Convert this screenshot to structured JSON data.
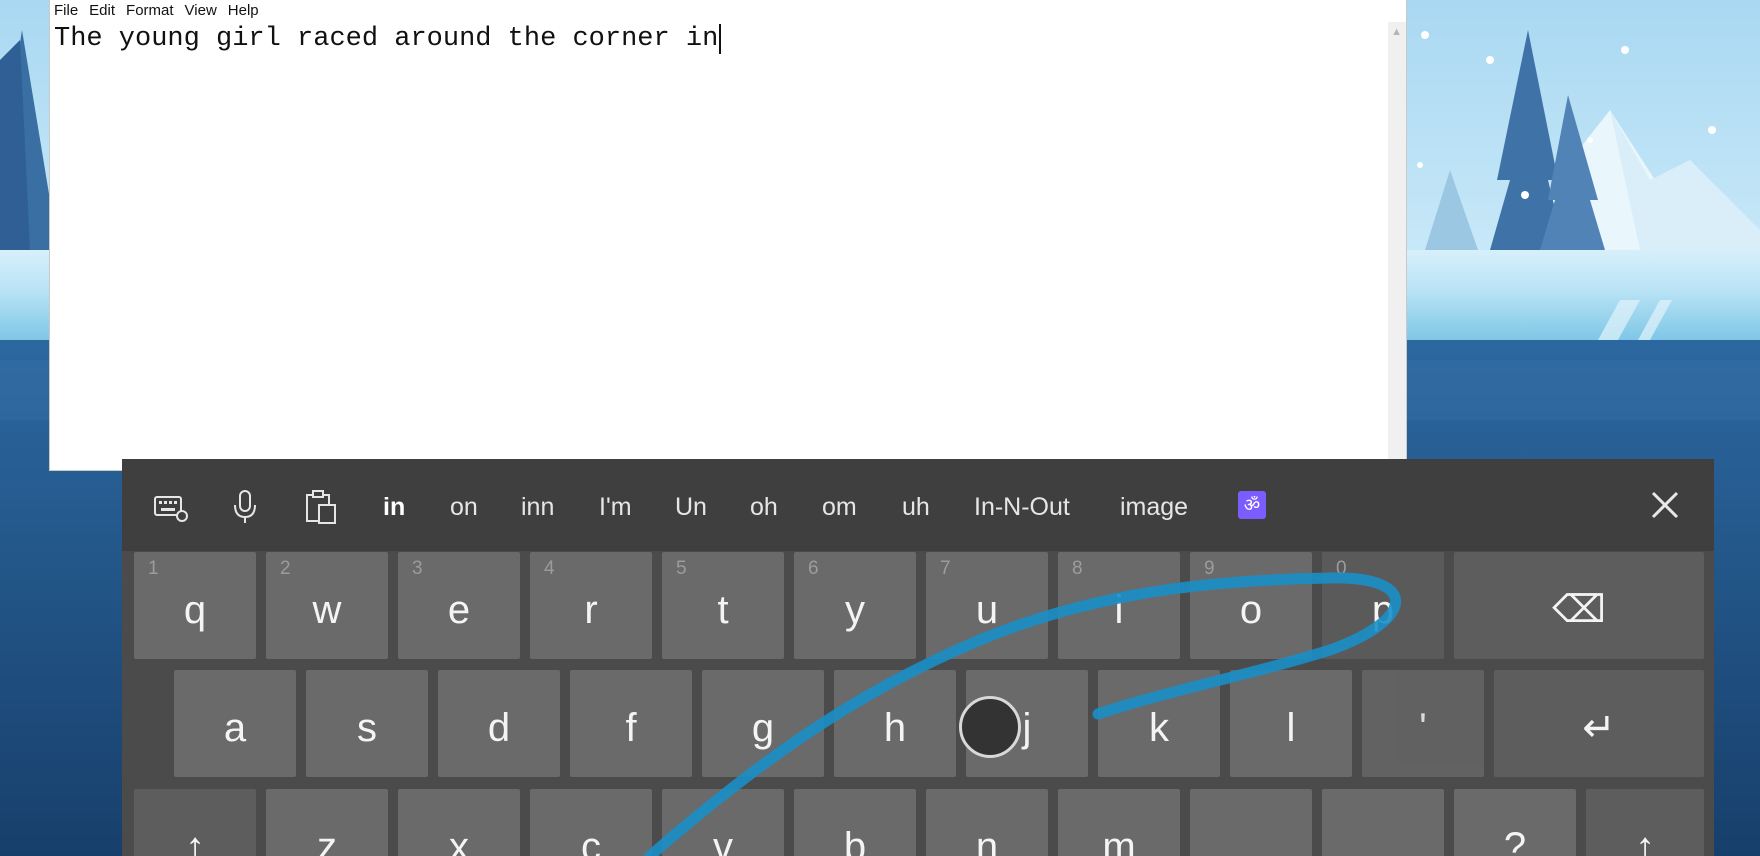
{
  "notepad": {
    "menu": [
      "File",
      "Edit",
      "Format",
      "View",
      "Help"
    ],
    "text": "The young girl raced around the corner in"
  },
  "keyboard": {
    "toolbar_icons": [
      "keyboard-settings-icon",
      "microphone-icon",
      "clipboard-icon"
    ],
    "suggestions": [
      "in",
      "on",
      "inn",
      "I'm",
      "Un",
      "oh",
      "om",
      "uh",
      "In-N-Out",
      "image"
    ],
    "emoji_glyph": "ॐ",
    "close_icon": "close-icon",
    "row1": [
      {
        "key": "q",
        "num": "1"
      },
      {
        "key": "w",
        "num": "2"
      },
      {
        "key": "e",
        "num": "3"
      },
      {
        "key": "r",
        "num": "4"
      },
      {
        "key": "t",
        "num": "5"
      },
      {
        "key": "y",
        "num": "6"
      },
      {
        "key": "u",
        "num": "7"
      },
      {
        "key": "i",
        "num": "8"
      },
      {
        "key": "o",
        "num": "9"
      },
      {
        "key": "p",
        "num": "0"
      }
    ],
    "row2": [
      "a",
      "s",
      "d",
      "f",
      "g",
      "h",
      "j",
      "k",
      "l",
      "'"
    ],
    "row3": [
      "z",
      "x",
      "c",
      "v",
      "b",
      "n",
      "m"
    ],
    "row3_extra": "?",
    "backspace_glyph": "⌫",
    "enter_glyph": "↵",
    "shift_glyph": "↑",
    "swipe_color": "#1a8fc7"
  }
}
